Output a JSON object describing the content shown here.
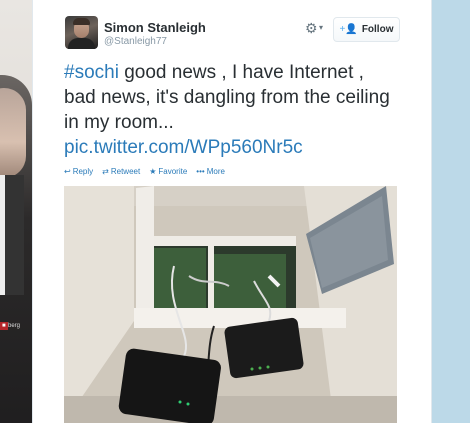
{
  "background": {
    "left_tag": "berg",
    "right_color": "#bcd9e8"
  },
  "tweet": {
    "author_name": "Simon Stanleigh",
    "author_handle": "@Stanleigh77",
    "follow_label": "Follow",
    "text_parts": {
      "hashtag": "#sochi",
      "body": " good news , I have Internet , bad news,  it's dangling from the ceiling  in my room...",
      "link": "pic.twitter.com/WPp560Nr5c"
    },
    "actions": [
      {
        "icon": "reply-icon",
        "glyph": "↩",
        "label": "Reply"
      },
      {
        "icon": "retweet-icon",
        "glyph": "⇄",
        "label": "Retweet"
      },
      {
        "icon": "favorite-icon",
        "glyph": "★",
        "label": "Favorite"
      },
      {
        "icon": "more-icon",
        "glyph": "•••",
        "label": "More"
      }
    ],
    "link_color": "#2b7bb9",
    "photo_alt": "Internet router and modem hanging from an open ceiling panel"
  }
}
